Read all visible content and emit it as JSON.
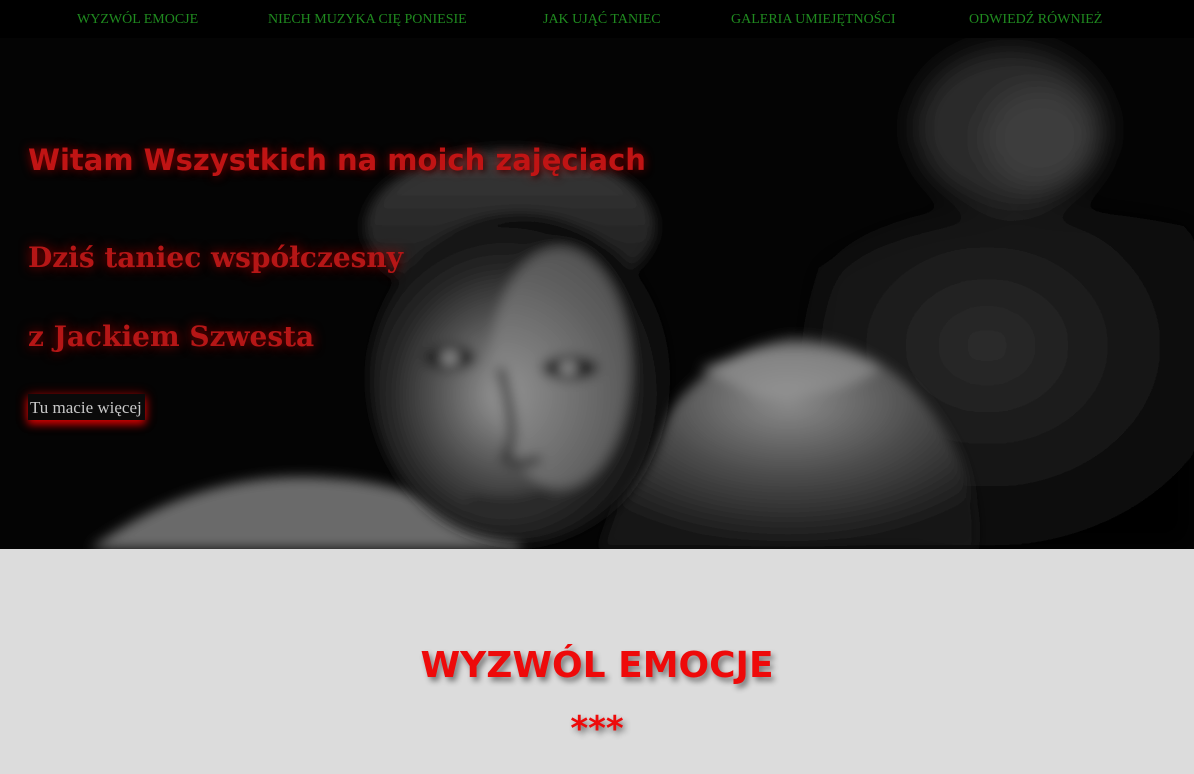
{
  "nav": {
    "items": [
      {
        "label": "WYZWÓL EMOCJE"
      },
      {
        "label": "NIECH MUZYKA CIĘ PONIESIE"
      },
      {
        "label": "JAK UJĄĆ TANIEC"
      },
      {
        "label": "GALERIA UMIEJĘTNOŚCI"
      },
      {
        "label": "ODWIEDŹ RÓWNIEŻ"
      }
    ],
    "color": "#1f8a1f"
  },
  "hero": {
    "title": "Witam Wszystkich na moich zajęciach",
    "subtitle_line1": "Dziś taniec współczesny",
    "subtitle_line2": "z Jackiem Szwesta",
    "button_label": "Tu macie więcej",
    "image": "black-and-white-portrait-photo",
    "accent_color": "#c01414"
  },
  "section": {
    "title": "WYZWÓL EMOCJE",
    "decoration": "***",
    "background": "#dcdcdc",
    "title_color": "#ee0a0a"
  }
}
